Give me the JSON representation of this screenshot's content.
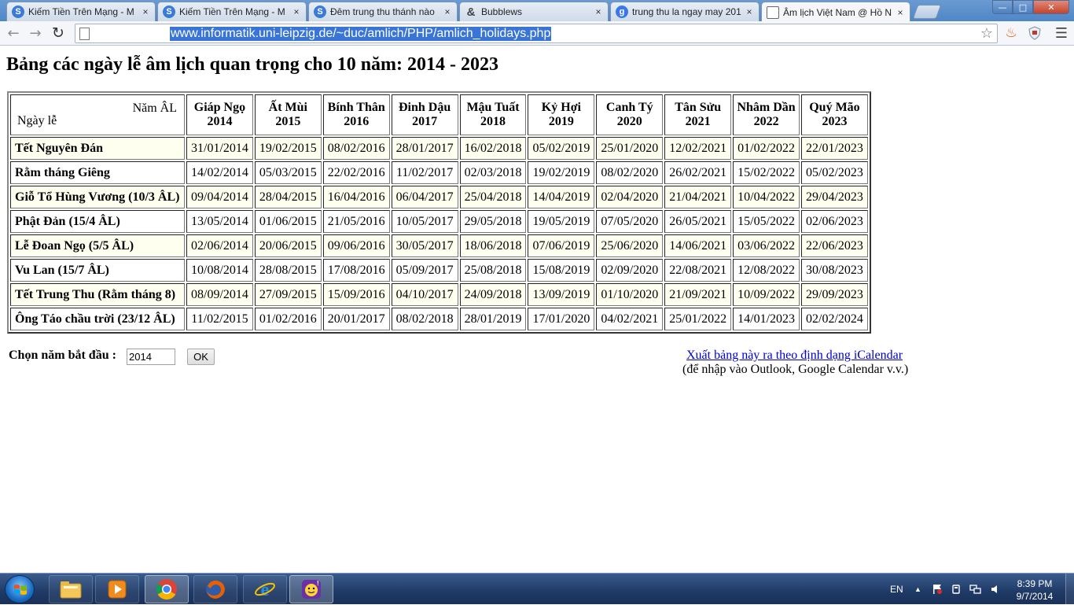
{
  "browser": {
    "tabs": [
      {
        "title": "Kiếm Tiền Trên Mạng - M",
        "icon": "globe-s-icon",
        "color": "#3a7bd5"
      },
      {
        "title": "Kiếm Tiền Trên Mạng - M",
        "icon": "globe-s-icon",
        "color": "#3a7bd5"
      },
      {
        "title": "Đêm trung thu thánh nào",
        "icon": "globe-s-icon",
        "color": "#3a7bd5"
      },
      {
        "title": "Bubblews",
        "icon": "ampersand-icon",
        "color": "#444444"
      },
      {
        "title": "trung thu la ngay may 201",
        "icon": "google-icon",
        "color": "#3b78e7"
      },
      {
        "title": "Âm lịch Việt Nam @ Hồ N",
        "icon": "page-icon",
        "color": "#666666"
      }
    ],
    "close_glyph": "×",
    "url": "www.informatik.uni-leipzig.de/~duc/amlich/PHP/amlich_holidays.php"
  },
  "page": {
    "title": "Bảng các ngày lễ âm lịch quan trọng cho 10 năm: 2014 - 2023",
    "corner_top": "Năm ÂL",
    "corner_bottom": "Ngày lễ",
    "years": [
      {
        "name": "Giáp Ngọ",
        "year": "2014"
      },
      {
        "name": "Ất Mùi",
        "year": "2015"
      },
      {
        "name": "Bính Thân",
        "year": "2016"
      },
      {
        "name": "Đinh Dậu",
        "year": "2017"
      },
      {
        "name": "Mậu Tuất",
        "year": "2018"
      },
      {
        "name": "Kỷ Hợi",
        "year": "2019"
      },
      {
        "name": "Canh Tý",
        "year": "2020"
      },
      {
        "name": "Tân Sửu",
        "year": "2021"
      },
      {
        "name": "Nhâm Dần",
        "year": "2022"
      },
      {
        "name": "Quý Mão",
        "year": "2023"
      }
    ],
    "rows": [
      {
        "holiday": "Tết Nguyên Đán",
        "dates": [
          "31/01/2014",
          "19/02/2015",
          "08/02/2016",
          "28/01/2017",
          "16/02/2018",
          "05/02/2019",
          "25/01/2020",
          "12/02/2021",
          "01/02/2022",
          "22/01/2023"
        ]
      },
      {
        "holiday": "Rằm tháng Giêng",
        "dates": [
          "14/02/2014",
          "05/03/2015",
          "22/02/2016",
          "11/02/2017",
          "02/03/2018",
          "19/02/2019",
          "08/02/2020",
          "26/02/2021",
          "15/02/2022",
          "05/02/2023"
        ]
      },
      {
        "holiday": "Giỗ Tổ Hùng Vương (10/3 ÂL)",
        "dates": [
          "09/04/2014",
          "28/04/2015",
          "16/04/2016",
          "06/04/2017",
          "25/04/2018",
          "14/04/2019",
          "02/04/2020",
          "21/04/2021",
          "10/04/2022",
          "29/04/2023"
        ]
      },
      {
        "holiday": "Phật Đản (15/4 ÂL)",
        "dates": [
          "13/05/2014",
          "01/06/2015",
          "21/05/2016",
          "10/05/2017",
          "29/05/2018",
          "19/05/2019",
          "07/05/2020",
          "26/05/2021",
          "15/05/2022",
          "02/06/2023"
        ]
      },
      {
        "holiday": "Lễ Đoan Ngọ (5/5 ÂL)",
        "dates": [
          "02/06/2014",
          "20/06/2015",
          "09/06/2016",
          "30/05/2017",
          "18/06/2018",
          "07/06/2019",
          "25/06/2020",
          "14/06/2021",
          "03/06/2022",
          "22/06/2023"
        ]
      },
      {
        "holiday": "Vu Lan (15/7 ÂL)",
        "dates": [
          "10/08/2014",
          "28/08/2015",
          "17/08/2016",
          "05/09/2017",
          "25/08/2018",
          "15/08/2019",
          "02/09/2020",
          "22/08/2021",
          "12/08/2022",
          "30/08/2023"
        ]
      },
      {
        "holiday": "Tết Trung Thu (Rằm tháng 8)",
        "dates": [
          "08/09/2014",
          "27/09/2015",
          "15/09/2016",
          "04/10/2017",
          "24/09/2018",
          "13/09/2019",
          "01/10/2020",
          "21/09/2021",
          "10/09/2022",
          "29/09/2023"
        ]
      },
      {
        "holiday": "Ông Táo chầu trời (23/12 ÂL)",
        "dates": [
          "11/02/2015",
          "01/02/2016",
          "20/01/2017",
          "08/02/2018",
          "28/01/2019",
          "17/01/2020",
          "04/02/2021",
          "25/01/2022",
          "14/01/2023",
          "02/02/2024"
        ]
      }
    ],
    "start_label": "Chọn năm bắt đầu :",
    "start_value": "2014",
    "ok_label": "OK",
    "ical_link": "Xuất bảng này ra theo định dạng iCalendar",
    "ical_note": "(để nhập vào Outlook, Google Calendar v.v.)"
  },
  "taskbar": {
    "apps": [
      "file-explorer-icon",
      "media-player-icon",
      "chrome-icon",
      "firefox-icon",
      "internet-explorer-icon",
      "yahoo-messenger-icon"
    ],
    "language": "EN",
    "time": "8:39 PM",
    "date": "9/7/2014"
  }
}
